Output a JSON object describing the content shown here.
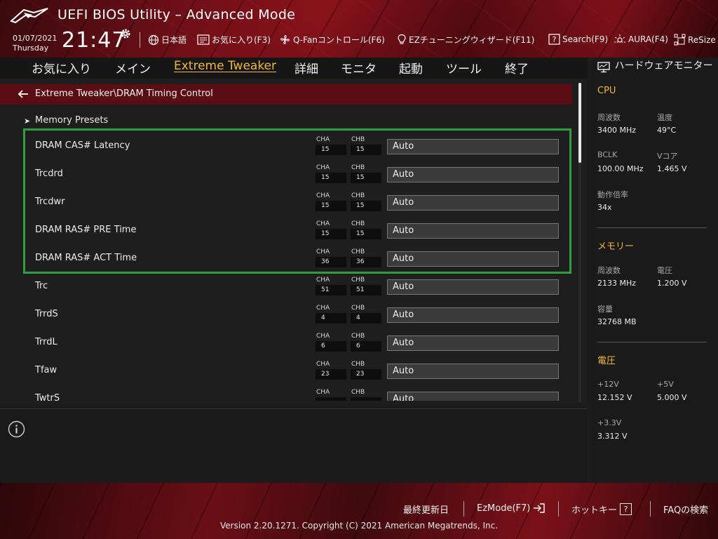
{
  "header": {
    "title": "UEFI BIOS Utility – Advanced Mode",
    "date": "01/07/2021",
    "weekday": "Thursday",
    "time": "21:47",
    "toolbar": {
      "language": "日本語",
      "favorites": "お気に入り(F3)",
      "qfan": "Q-Fanコントロール(F6)",
      "ez_wizard": "EZチューニングウィザード(F11)",
      "search": "Search(F9)",
      "aura": "AURA(F4)",
      "resize": "ReSize"
    }
  },
  "tabs": [
    {
      "label": "お気に入り",
      "active": false
    },
    {
      "label": "メイン",
      "active": false
    },
    {
      "label": "Extreme Tweaker",
      "active": true
    },
    {
      "label": "詳細",
      "active": false
    },
    {
      "label": "モニタ",
      "active": false
    },
    {
      "label": "起動",
      "active": false
    },
    {
      "label": "ツール",
      "active": false
    },
    {
      "label": "終了",
      "active": false
    }
  ],
  "breadcrumb": "Extreme Tweaker\\DRAM Timing Control",
  "memory_presets": "Memory Presets",
  "channel_labels": {
    "a": "CHA",
    "b": "CHB"
  },
  "settings": [
    {
      "label": "DRAM CAS# Latency",
      "cha": "15",
      "chb": "15",
      "value": "Auto"
    },
    {
      "label": "Trcdrd",
      "cha": "15",
      "chb": "15",
      "value": "Auto"
    },
    {
      "label": "Trcdwr",
      "cha": "15",
      "chb": "15",
      "value": "Auto"
    },
    {
      "label": "DRAM RAS# PRE Time",
      "cha": "15",
      "chb": "15",
      "value": "Auto"
    },
    {
      "label": "DRAM RAS# ACT Time",
      "cha": "36",
      "chb": "36",
      "value": "Auto"
    },
    {
      "label": "Trc",
      "cha": "51",
      "chb": "51",
      "value": "Auto"
    },
    {
      "label": "TrrdS",
      "cha": "4",
      "chb": "4",
      "value": "Auto"
    },
    {
      "label": "TrrdL",
      "cha": "6",
      "chb": "6",
      "value": "Auto"
    },
    {
      "label": "Tfaw",
      "cha": "23",
      "chb": "23",
      "value": "Auto"
    },
    {
      "label": "TwtrS",
      "cha": "",
      "chb": "",
      "value": "Auto"
    }
  ],
  "hardware_monitor": {
    "title": "ハードウェアモニター",
    "cpu": {
      "heading": "CPU",
      "freq_label": "周波数",
      "freq": "3400 MHz",
      "temp_label": "温度",
      "temp": "49°C",
      "bclk_label": "BCLK",
      "bclk": "100.00 MHz",
      "vcore_label": "Vコア",
      "vcore": "1.465 V",
      "ratio_label": "動作倍率",
      "ratio": "34x"
    },
    "memory": {
      "heading": "メモリー",
      "freq_label": "周波数",
      "freq": "2133 MHz",
      "volt_label": "電圧",
      "volt": "1.200 V",
      "cap_label": "容量",
      "cap": "32768 MB"
    },
    "voltage": {
      "heading": "電圧",
      "v12_label": "+12V",
      "v12": "12.152 V",
      "v5_label": "+5V",
      "v5": "5.000 V",
      "v33_label": "+3.3V",
      "v33": "3.312 V"
    }
  },
  "footer": {
    "last_modified": "最終更新日",
    "ezmode": "EzMode(F7)",
    "hotkeys": "ホットキー",
    "hotkey_glyph": "?",
    "faq": "FAQの検索",
    "version": "Version 2.20.1271. Copyright (C) 2021 American Megatrends, Inc."
  },
  "colors": {
    "accent": "#f2b632",
    "highlight_border": "#2ea043",
    "breadcrumb_bg": "#5a0d12"
  },
  "icons": [
    "logo-icon",
    "gear-icon",
    "globe-icon",
    "favorites-icon",
    "fan-icon",
    "bulb-icon",
    "help-icon",
    "aura-icon",
    "resize-icon",
    "back-arrow-icon",
    "chevron-right-icon",
    "info-icon",
    "monitor-icon",
    "exit-arrow-icon"
  ]
}
